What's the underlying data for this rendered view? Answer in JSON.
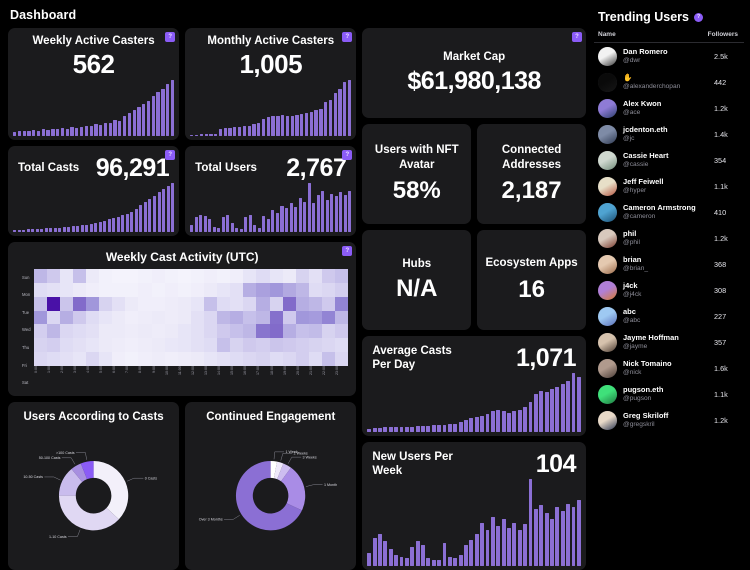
{
  "header": {
    "title": "Dashboard"
  },
  "help_badge": "?",
  "cards": {
    "weekly_active_casters": {
      "label": "Weekly Active Casters",
      "value": "562"
    },
    "monthly_active_casters": {
      "label": "Monthly Active Casters",
      "value": "1,005"
    },
    "total_casts": {
      "label": "Total Casts",
      "value": "96,291"
    },
    "total_users": {
      "label": "Total Users",
      "value": "2,767"
    },
    "market_cap": {
      "label": "Market Cap",
      "value": "$61,980,138"
    },
    "users_with_nft_avatar": {
      "label": "Users with NFT Avatar",
      "value": "58%"
    },
    "connected_addresses": {
      "label": "Connected Addresses",
      "value": "2,187"
    },
    "hubs": {
      "label": "Hubs",
      "value": "N/A"
    },
    "ecosystem_apps": {
      "label": "Ecosystem Apps",
      "value": "16"
    },
    "average_casts_per_day": {
      "label": "Average Casts Per Day",
      "value": "1,071"
    },
    "new_users_per_week": {
      "label": "New Users Per Week",
      "value": "104"
    }
  },
  "sidebar": {
    "title": "Trending Users",
    "badge": "?",
    "col_name": "Name",
    "col_followers": "Followers",
    "users": [
      {
        "name": "Dan Romero",
        "handle": "@dwr",
        "followers": "2.5k",
        "c1": "#f2f2f2",
        "c2": "#3a3a3a"
      },
      {
        "name": "",
        "handle": "@alexanderchopan",
        "followers": "442",
        "c1": "#0a0a0a",
        "c2": "#161616"
      },
      {
        "name": "Alex Kwon",
        "handle": "@ace",
        "followers": "1.2k",
        "c1": "#8e7bd6",
        "c2": "#2b3f6b"
      },
      {
        "name": "jcdenton.eth",
        "handle": "@jc",
        "followers": "1.4k",
        "c1": "#7e8ba6",
        "c2": "#2f3a52"
      },
      {
        "name": "Cassie Heart",
        "handle": "@cassie",
        "followers": "354",
        "c1": "#cfd8cf",
        "c2": "#6f8a78"
      },
      {
        "name": "Jeff Feiwell",
        "handle": "@hyper",
        "followers": "1.1k",
        "c1": "#e7dfc8",
        "c2": "#b4543f"
      },
      {
        "name": "Cameron Armstrong",
        "handle": "@cameron",
        "followers": "410",
        "c1": "#4fa3d1",
        "c2": "#1b4f73"
      },
      {
        "name": "phil",
        "handle": "@phil",
        "followers": "1.2k",
        "c1": "#d8c9bd",
        "c2": "#7a3b2e"
      },
      {
        "name": "brian",
        "handle": "@brian_",
        "followers": "368",
        "c1": "#e4c9b0",
        "c2": "#9c6b4a"
      },
      {
        "name": "j4ck",
        "handle": "@j4ck",
        "followers": "308",
        "c1": "#b07fd6",
        "c2": "#d97b2f"
      },
      {
        "name": "abc",
        "handle": "@abc",
        "followers": "227",
        "c1": "#9ec9f2",
        "c2": "#5a6fb8"
      },
      {
        "name": "Jayme Hoffman",
        "handle": "@jayme",
        "followers": "357",
        "c1": "#d6c2ad",
        "c2": "#4a3a30"
      },
      {
        "name": "Nick Tomaino",
        "handle": "@nick",
        "followers": "1.6k",
        "c1": "#b09a8d",
        "c2": "#4a3c36"
      },
      {
        "name": "pugson.eth",
        "handle": "@pugson",
        "followers": "1.1k",
        "c1": "#3fe07a",
        "c2": "#1f7a42"
      },
      {
        "name": "Greg Skriloff",
        "handle": "@gregskril",
        "followers": "1.2k",
        "c1": "#e8d9c8",
        "c2": "#2a3550"
      }
    ]
  },
  "chart_data": [
    {
      "type": "bar",
      "title": "Weekly Active Casters",
      "values": [
        7,
        8,
        9,
        8,
        10,
        9,
        11,
        10,
        12,
        11,
        13,
        12,
        14,
        13,
        15,
        17,
        16,
        19,
        18,
        22,
        21,
        26,
        25,
        33,
        38,
        42,
        47,
        52,
        58,
        65,
        72,
        78,
        86,
        92
      ],
      "ylim": [
        0,
        100
      ]
    },
    {
      "type": "bar",
      "title": "Monthly Active Casters",
      "values": [
        2,
        2,
        3,
        3,
        4,
        4,
        12,
        13,
        14,
        15,
        16,
        17,
        18,
        20,
        22,
        30,
        32,
        34,
        35,
        36,
        34,
        35,
        36,
        38,
        40,
        42,
        44,
        46,
        58,
        62,
        74,
        80,
        92,
        96
      ],
      "ylim": [
        0,
        100
      ]
    },
    {
      "type": "bar",
      "title": "Total Casts",
      "values": [
        3,
        4,
        4,
        5,
        5,
        6,
        6,
        7,
        7,
        8,
        8,
        9,
        10,
        11,
        12,
        13,
        14,
        16,
        18,
        20,
        22,
        25,
        28,
        30,
        33,
        36,
        40,
        45,
        52,
        58,
        64,
        70,
        78,
        84,
        90,
        96
      ],
      "ylim": [
        0,
        100
      ]
    },
    {
      "type": "bar",
      "title": "Total Users",
      "values": [
        10,
        22,
        26,
        24,
        20,
        8,
        6,
        22,
        26,
        14,
        6,
        4,
        22,
        26,
        10,
        6,
        24,
        20,
        34,
        28,
        40,
        36,
        44,
        38,
        52,
        46,
        74,
        44,
        56,
        62,
        48,
        58,
        54,
        60,
        56,
        62
      ],
      "ylim": [
        0,
        100
      ]
    },
    {
      "type": "bar",
      "title": "Average Casts Per Day",
      "values": [
        4,
        6,
        6,
        7,
        7,
        7,
        8,
        8,
        8,
        9,
        9,
        9,
        10,
        10,
        10,
        11,
        12,
        14,
        18,
        20,
        22,
        24,
        26,
        30,
        32,
        30,
        28,
        30,
        32,
        36,
        44,
        56,
        60,
        58,
        62,
        66,
        70,
        74,
        86,
        80
      ],
      "ylim": [
        0,
        100
      ]
    },
    {
      "type": "bar",
      "title": "New Users Per Week",
      "values": [
        14,
        30,
        34,
        26,
        18,
        12,
        10,
        8,
        20,
        26,
        22,
        8,
        6,
        6,
        24,
        10,
        8,
        12,
        22,
        28,
        34,
        46,
        38,
        52,
        42,
        50,
        40,
        46,
        38,
        44,
        92,
        60,
        64,
        56,
        50,
        62,
        58,
        66,
        62,
        70
      ],
      "ylim": [
        0,
        100
      ]
    },
    {
      "type": "heatmap",
      "title": "Weekly Cast Activity (UTC)",
      "ylabels": [
        "Sun",
        "Mon",
        "Tue",
        "Wed",
        "Thu",
        "Fri",
        "Sat"
      ],
      "xlabels": [
        "0:00",
        "1:00",
        "2:00",
        "3:00",
        "4:00",
        "5:00",
        "6:00",
        "7:00",
        "8:00",
        "9:00",
        "10:00",
        "11:00",
        "12:00",
        "13:00",
        "14:00",
        "15:00",
        "16:00",
        "17:00",
        "18:00",
        "19:00",
        "20:00",
        "21:00",
        "22:00",
        "23:00"
      ],
      "values": [
        [
          0.3,
          0.22,
          0.1,
          0.26,
          0.08,
          0.05,
          0.04,
          0.04,
          0.05,
          0.06,
          0.05,
          0.04,
          0.05,
          0.06,
          0.05,
          0.06,
          0.1,
          0.14,
          0.1,
          0.08,
          0.18,
          0.12,
          0.22,
          0.26
        ],
        [
          0.14,
          0.12,
          0.1,
          0.08,
          0.06,
          0.05,
          0.05,
          0.05,
          0.06,
          0.05,
          0.06,
          0.05,
          0.06,
          0.08,
          0.1,
          0.12,
          0.34,
          0.4,
          0.44,
          0.36,
          0.3,
          0.14,
          0.16,
          0.2
        ],
        [
          0.26,
          0.98,
          0.24,
          0.62,
          0.44,
          0.18,
          0.12,
          0.08,
          0.06,
          0.06,
          0.07,
          0.08,
          0.1,
          0.26,
          0.14,
          0.12,
          0.16,
          0.34,
          0.18,
          0.62,
          0.34,
          0.3,
          0.22,
          0.52
        ],
        [
          0.44,
          0.16,
          0.34,
          0.22,
          0.14,
          0.1,
          0.08,
          0.06,
          0.07,
          0.08,
          0.07,
          0.08,
          0.12,
          0.16,
          0.3,
          0.34,
          0.26,
          0.3,
          0.6,
          0.22,
          0.44,
          0.42,
          0.52,
          0.3
        ],
        [
          0.2,
          0.3,
          0.16,
          0.14,
          0.12,
          0.08,
          0.08,
          0.07,
          0.08,
          0.07,
          0.08,
          0.1,
          0.12,
          0.16,
          0.22,
          0.26,
          0.3,
          0.58,
          0.62,
          0.34,
          0.26,
          0.28,
          0.18,
          0.22
        ],
        [
          0.18,
          0.2,
          0.14,
          0.12,
          0.1,
          0.08,
          0.07,
          0.06,
          0.07,
          0.08,
          0.09,
          0.1,
          0.12,
          0.14,
          0.26,
          0.18,
          0.22,
          0.2,
          0.24,
          0.22,
          0.2,
          0.18,
          0.16,
          0.14
        ],
        [
          0.16,
          0.14,
          0.12,
          0.1,
          0.16,
          0.1,
          0.06,
          0.05,
          0.06,
          0.07,
          0.06,
          0.07,
          0.08,
          0.1,
          0.12,
          0.14,
          0.16,
          0.18,
          0.14,
          0.16,
          0.2,
          0.14,
          0.26,
          0.16
        ]
      ]
    },
    {
      "type": "pie",
      "title": "Users According to Casts",
      "labels": [
        "0 Casts",
        "1-10 Casts",
        "10-50 Casts",
        "50-100 Casts",
        ">100 Casts"
      ],
      "values": [
        37,
        38,
        14,
        5,
        6
      ],
      "colors": [
        "#f3f0fa",
        "#e0d8f3",
        "#c9bced",
        "#a78fe0",
        "#8b5cf6"
      ]
    },
    {
      "type": "pie",
      "title": "Continued Engagement",
      "labels": [
        "1 Week",
        "2 Weeks",
        "3 Weeks",
        "1 Month",
        "Over 3 Months"
      ],
      "values": [
        3,
        3,
        4,
        22,
        68
      ],
      "colors": [
        "#ffffff",
        "#efe9fb",
        "#cdbdf0",
        "#a98ce6",
        "#8b6fd4"
      ]
    }
  ]
}
